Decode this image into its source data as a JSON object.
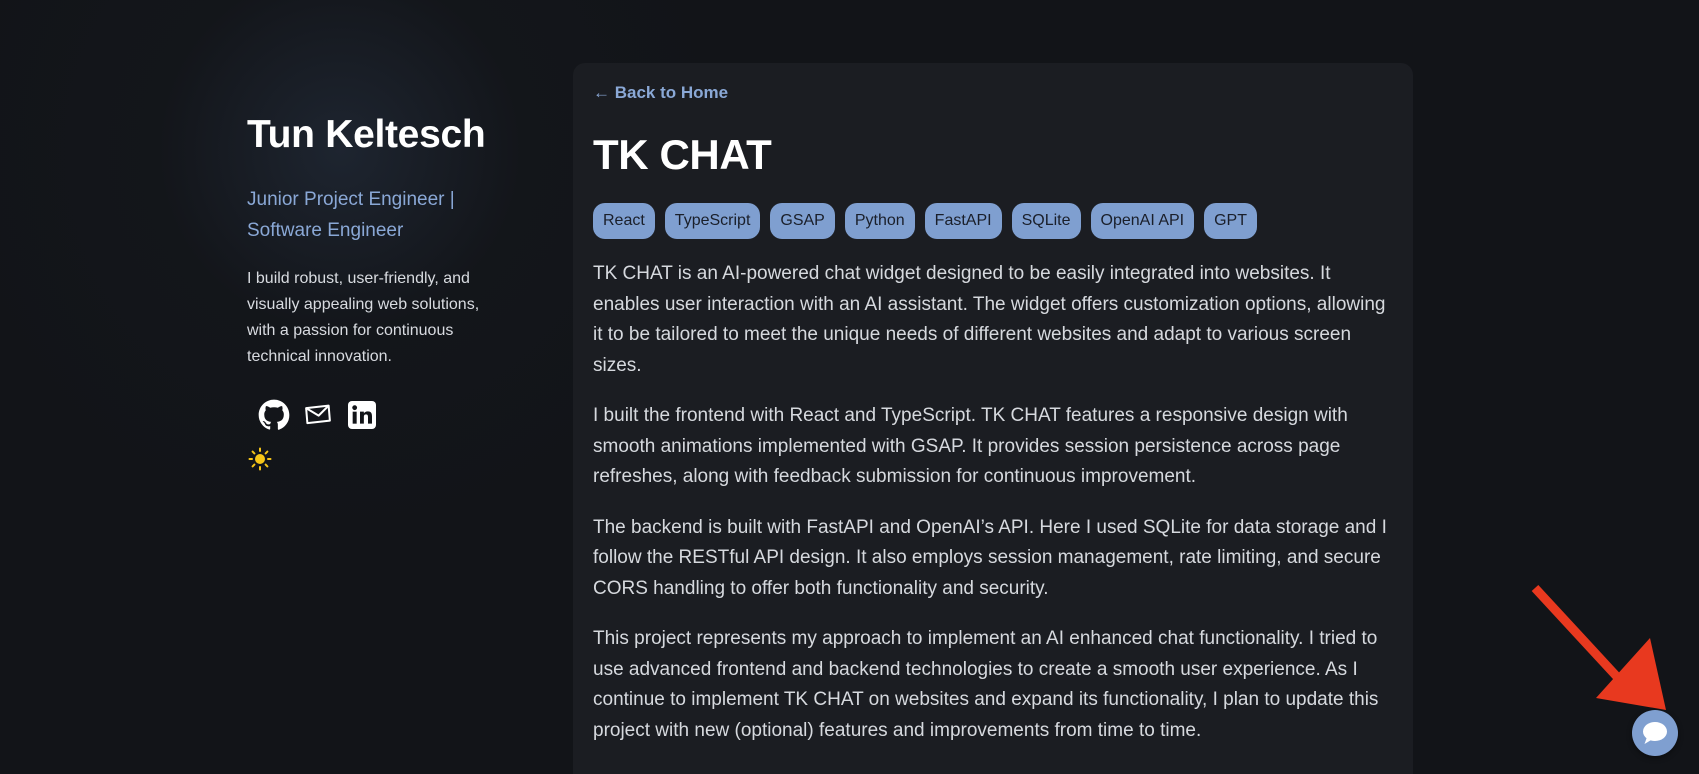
{
  "sidebar": {
    "name": "Tun Keltesch",
    "role": "Junior Project Engineer |\n Software Engineer",
    "bio": "I build robust, user-friendly, and visually appealing web solutions, with a passion for continuous technical innovation.",
    "social_icons": [
      "github-icon",
      "mail-icon",
      "linkedin-icon"
    ],
    "theme_icon": "sun-icon"
  },
  "project": {
    "back_label": "← Back to Home",
    "title": "TK CHAT",
    "tags": [
      "React",
      "TypeScript",
      "GSAP",
      "Python",
      "FastAPI",
      "SQLite",
      "OpenAI API",
      "GPT"
    ],
    "paragraphs": [
      "TK CHAT is an AI-powered chat widget designed to be easily integrated into websites. It enables user interaction with an AI assistant. The widget offers customization options, allowing it to be tailored to meet the unique needs of different websites and adapt to various screen sizes.",
      "I built the frontend with React and TypeScript. TK CHAT features a responsive design with smooth animations implemented with GSAP. It provides session persistence across page refreshes, along with feedback submission for continuous improvement.",
      "The backend is built with FastAPI and OpenAI’s API. Here I used SQLite for data storage and I follow the RESTful API design. It also employs session management, rate limiting, and secure CORS handling to offer both functionality and security.",
      "This project represents my approach to implement an AI enhanced chat functionality. I tried to use advanced frontend and backend technologies to create a smooth user experience. As I continue to implement TK CHAT on websites and expand its functionality, I plan to update this project with new (optional) features and improvements from time to time."
    ]
  },
  "chat_widget": {
    "icon": "chat-bubble-icon"
  },
  "colors": {
    "background": "#121418",
    "card": "#1b1d22",
    "accent": "#8aa8d6",
    "tag_bg": "#7f9fd0",
    "annotation_arrow": "#e8391f"
  }
}
